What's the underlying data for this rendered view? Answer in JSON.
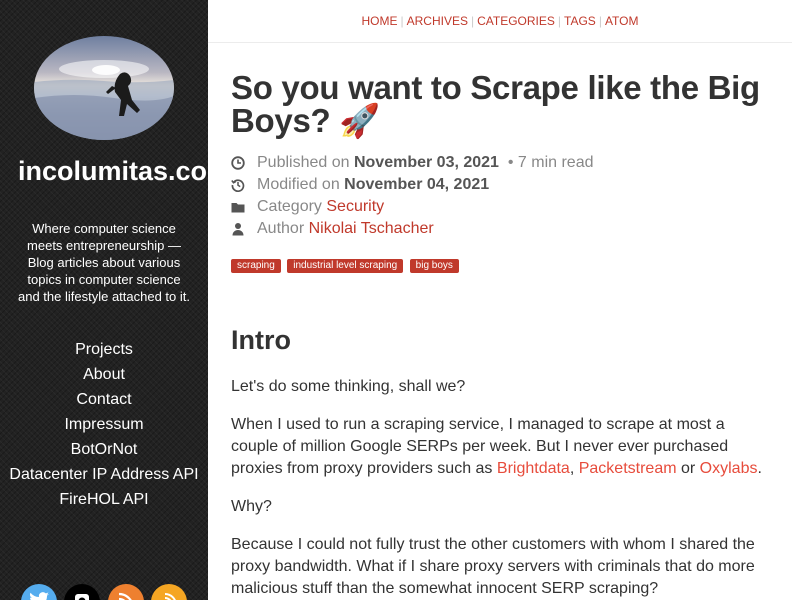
{
  "sidebar": {
    "site_title": "incolumitas.com",
    "description": "Where computer science meets entrepreneurship — Blog articles about various topics in computer science and the lifestyle attached to it.",
    "links": [
      "Projects",
      "About",
      "Contact",
      "Impressum",
      "BotOrNot",
      "Datacenter IP Address API",
      "FireHOL API"
    ],
    "socials": [
      {
        "name": "twitter",
        "color": "#55acee"
      },
      {
        "name": "github",
        "color": "#000000"
      },
      {
        "name": "rss",
        "color": "#ee802f"
      },
      {
        "name": "atom",
        "color": "#f5a623"
      }
    ]
  },
  "topnav": {
    "items": [
      "HOME",
      "ARCHIVES",
      "CATEGORIES",
      "TAGS",
      "ATOM"
    ]
  },
  "post": {
    "title": "So you want to Scrape like the Big Boys? 🚀",
    "published_label": "Published on",
    "published_date": "November 03, 2021",
    "read_time": "• 7 min read",
    "modified_label": "Modified on",
    "modified_date": "November 04, 2021",
    "category_label": "Category",
    "category": "Security",
    "author_label": "Author",
    "author": "Nikolai Tschacher",
    "tags": [
      "scraping",
      "industrial level scraping",
      "big boys"
    ]
  },
  "content": {
    "heading": "Intro",
    "p1": "Let's do some thinking, shall we?",
    "p2_text": "When I used to run a scraping service, I managed to scrape at most a couple of million Google SERPs per week. But I never ever purchased proxies from proxy providers such as",
    "p2_link1": "Brightdata",
    "p2_sep1": ",",
    "p2_link2": "Packetstream",
    "p2_sep2": " or ",
    "p2_link3": "Oxylabs",
    "p2_end": ".",
    "p3": "Why?",
    "p4": "Because I could not fully trust the other customers with whom I shared the proxy bandwidth. What if I share proxy servers with criminals that do more malicious stuff than the somewhat innocent SERP scraping?"
  },
  "colors": {
    "accent": "#c0392b",
    "link": "#e74c3c",
    "sidebar_bg": "#222222"
  }
}
